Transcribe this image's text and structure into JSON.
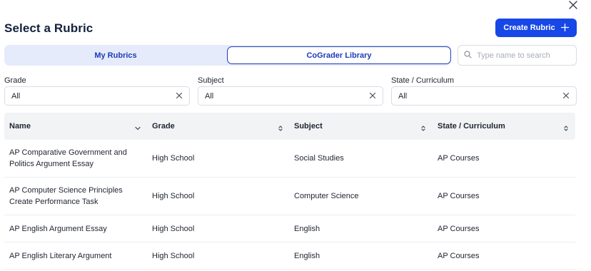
{
  "modal": {
    "title": "Select a Rubric",
    "create_button_label": "Create Rubric",
    "create_button_icon": "plus-icon",
    "close_icon": "close-icon"
  },
  "tabs": [
    {
      "label": "My Rubrics",
      "active": false
    },
    {
      "label": "CoGrader Library",
      "active": true
    }
  ],
  "search": {
    "placeholder": "Type name to search",
    "value": "",
    "icon": "search-icon"
  },
  "filters": {
    "grade": {
      "label": "Grade",
      "value": "All"
    },
    "subject": {
      "label": "Subject",
      "value": "All"
    },
    "state": {
      "label": "State / Curriculum",
      "value": "All"
    }
  },
  "table": {
    "columns": [
      {
        "label": "Name",
        "sort_icon": "chevron-down-icon"
      },
      {
        "label": "Grade",
        "sort_icon": "sort-updown-icon"
      },
      {
        "label": "Subject",
        "sort_icon": "sort-updown-icon"
      },
      {
        "label": "State / Curriculum",
        "sort_icon": "sort-updown-icon"
      }
    ],
    "rows": [
      {
        "name_line1": "AP Comparative Government and",
        "name_line2": "Politics Argument Essay",
        "grade": "High School",
        "subject": "Social Studies",
        "state": "AP Courses"
      },
      {
        "name_line1": "AP Computer Science Principles",
        "name_line2": "Create Performance Task",
        "grade": "High School",
        "subject": "Computer Science",
        "state": "AP Courses"
      },
      {
        "name_line1": "AP English Argument Essay",
        "name_line2": "",
        "grade": "High School",
        "subject": "English",
        "state": "AP Courses"
      },
      {
        "name_line1": "AP English Literary Argument",
        "name_line2": "",
        "grade": "High School",
        "subject": "English",
        "state": "AP Courses"
      }
    ]
  },
  "colors": {
    "accent": "#1747e6",
    "tab_bg": "#e6ebfb",
    "tab_text": "#1d3bb8",
    "header_bg": "#f2f3f5"
  }
}
